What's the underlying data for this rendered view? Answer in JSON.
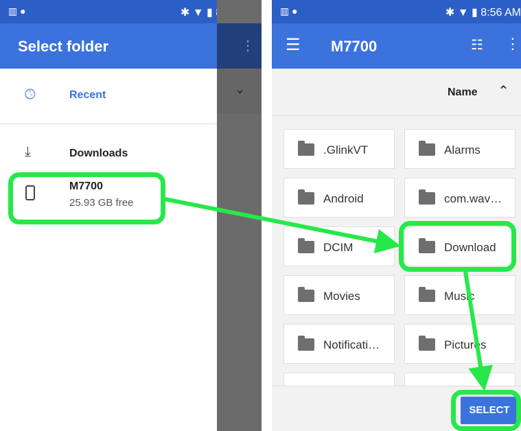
{
  "status": {
    "time": "8:56 AM"
  },
  "left": {
    "title": "Select folder",
    "recent": "Recent",
    "downloads": "Downloads",
    "device": {
      "name": "M7700",
      "free": "25.93 GB free"
    }
  },
  "right": {
    "title": "M7700",
    "sort_label": "Name",
    "folders": [
      ".GlinkVT",
      "Alarms",
      "Android",
      "com.wav…",
      "DCIM",
      "Download",
      "Movies",
      "Music",
      "Notificati…",
      "Pictures"
    ],
    "select_label": "SELECT"
  },
  "colors": {
    "accent": "#3b72dc",
    "status_bar": "#2c5ec7",
    "highlight": "#27e84a",
    "recent_text": "#3b72dc"
  }
}
